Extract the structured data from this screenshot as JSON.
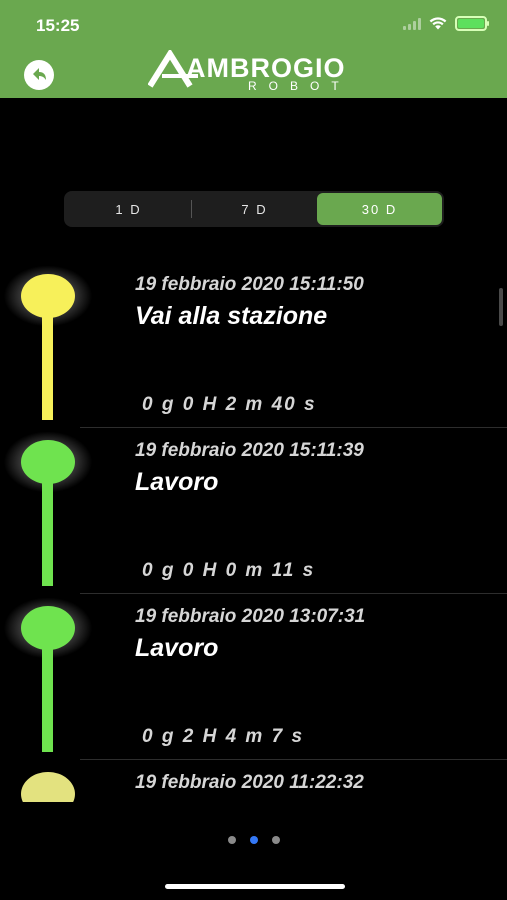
{
  "status_bar": {
    "time": "15:25"
  },
  "header": {
    "logo_word": "AMBROGIO",
    "logo_sub": "ROBOT",
    "back_icon": "back-arrow-icon",
    "background": "#6aa84f"
  },
  "range_selector": {
    "options": [
      "1 D",
      "7 D",
      "30 D"
    ],
    "selected": "30 D",
    "active_color": "#6aa84f"
  },
  "events": [
    {
      "date": "19 febbraio 2020 15:11:50",
      "title": "Vai alla stazione",
      "duration": "0 g 0 H 2 m 40 s",
      "color": "#f7f05a"
    },
    {
      "date": "19 febbraio 2020 15:11:39",
      "title": "Lavoro",
      "duration": "0 g 0 H 0 m 11 s",
      "color": "#6fe34f"
    },
    {
      "date": "19 febbraio 2020 13:07:31",
      "title": "Lavoro",
      "duration": "0 g 2 H 4 m 7 s",
      "color": "#6fe34f"
    },
    {
      "date": "19 febbraio 2020 11:22:32",
      "title": "",
      "duration": "",
      "color": "#e3e27f"
    }
  ],
  "pager": {
    "count": 3,
    "active_index": 1
  }
}
